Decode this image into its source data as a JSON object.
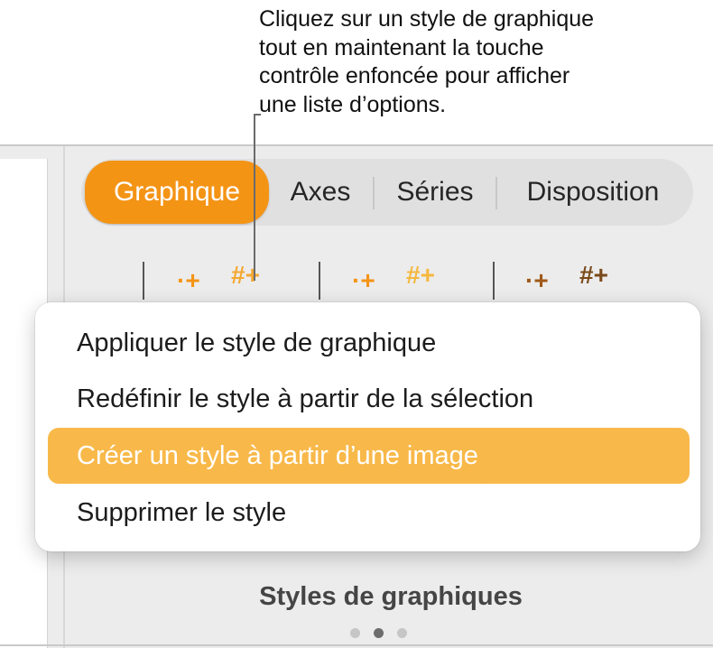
{
  "callout": {
    "lines": [
      "Cliquez sur un style de graphique",
      "tout en maintenant la touche",
      "contrôle enfoncée pour afficher",
      "une liste d’options."
    ]
  },
  "tabs": [
    {
      "label": "Graphique",
      "active": true
    },
    {
      "label": "Axes",
      "active": false
    },
    {
      "label": "Séries",
      "active": false
    },
    {
      "label": "Disposition",
      "active": false
    }
  ],
  "menu": {
    "items": [
      {
        "label": "Appliquer le style de graphique",
        "highlighted": false
      },
      {
        "label": "Redéfinir le style à partir de la sélection",
        "highlighted": false
      },
      {
        "label": "Créer un style à partir d’une image",
        "highlighted": true
      },
      {
        "label": "Supprimer le style",
        "highlighted": false
      }
    ]
  },
  "styles_section": {
    "title": "Styles de graphiques",
    "page_count": 3,
    "current_page": 2
  },
  "colors": {
    "accent": "#f49415",
    "menu_highlight": "#f8b94a"
  }
}
